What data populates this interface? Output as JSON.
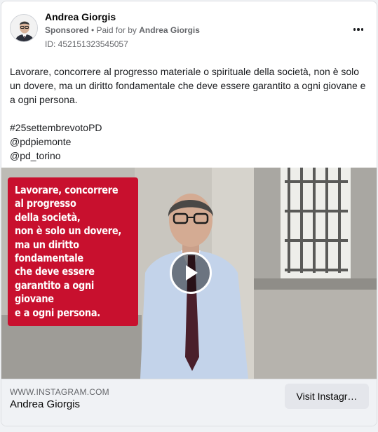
{
  "post": {
    "author": "Andrea Giorgis",
    "sponsored": "Sponsored",
    "separator": " • ",
    "paid_for_prefix": "Paid for by ",
    "paid_for_name": "Andrea Giorgis",
    "ad_id": "ID: 452151323545057",
    "more_icon": "more-horizontal-icon"
  },
  "body": {
    "paragraph": "Lavorare, concorrere al progresso materiale o spirituale della società, non è solo un dovere, ma un diritto fondamentale che deve essere garantito a ogni giovane e a ogni persona.",
    "hashtag": "#25settembrevotoPD",
    "mention1": "@pdpiemonte",
    "mention2": "@pd_torino"
  },
  "media": {
    "overlay_lines": [
      "Lavorare, concorrere",
      "al progresso",
      "della società,",
      "non è solo un dovere,",
      "ma un diritto",
      "fondamentale",
      "che deve essere",
      "garantito a ogni",
      "giovane",
      "e a ogni persona."
    ],
    "overlay_color": "#c8102e",
    "play_icon": "play-icon"
  },
  "footer": {
    "domain": "WWW.INSTAGRAM.COM",
    "name": "Andrea Giorgis",
    "cta_label": "Visit Instagr…"
  }
}
